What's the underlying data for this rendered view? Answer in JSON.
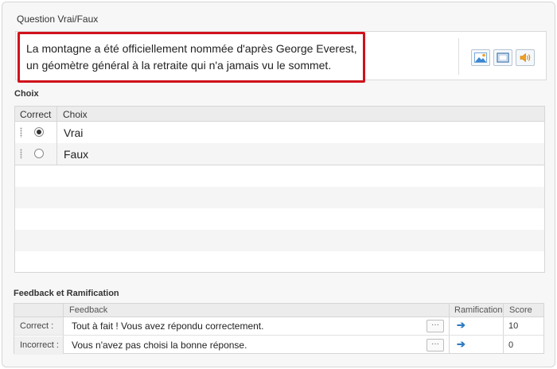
{
  "question": {
    "section_label": "Question Vrai/Faux",
    "text_line1": "La montagne a été officiellement nommée d'après George Everest,",
    "text_line2": "un géomètre général à la retraite qui n'a jamais vu le sommet.",
    "media_buttons": [
      {
        "icon": "image-icon"
      },
      {
        "icon": "video-icon"
      },
      {
        "icon": "audio-icon"
      }
    ],
    "highlight_color": "#d0121c"
  },
  "choices": {
    "section_label": "Choix",
    "headers": {
      "correct": "Correct",
      "choice": "Choix"
    },
    "items": [
      {
        "label": "Vrai",
        "correct": true
      },
      {
        "label": "Faux",
        "correct": false
      }
    ]
  },
  "feedback": {
    "section_label": "Feedback et Ramification",
    "headers": {
      "feedback": "Feedback",
      "branching": "Ramification",
      "score": "Score"
    },
    "rows": [
      {
        "label": "Correct :",
        "text": "Tout à fait ! Vous avez répondu correctement.",
        "more": "···",
        "score": "10"
      },
      {
        "label": "Incorrect :",
        "text": "Vous n'avez pas choisi la bonne réponse.",
        "more": "···",
        "score": "0"
      }
    ],
    "arrow_color": "#2e7bc4"
  }
}
